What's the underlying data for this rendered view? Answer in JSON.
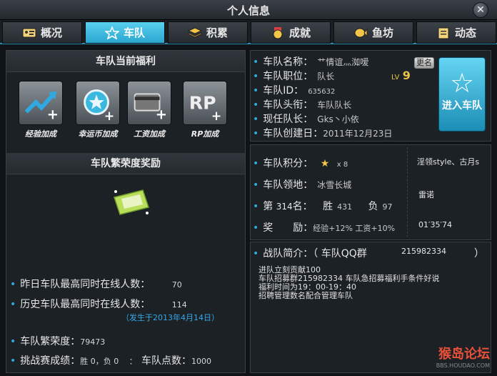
{
  "window": {
    "title": "个人信息",
    "close_glyph": "✕"
  },
  "tabs": [
    {
      "label": "概况",
      "icon": "id-card-icon",
      "active": false
    },
    {
      "label": "车队",
      "icon": "star-icon",
      "active": true
    },
    {
      "label": "积累",
      "icon": "stack-icon",
      "active": false
    },
    {
      "label": "成就",
      "icon": "medal-icon",
      "active": false
    },
    {
      "label": "鱼坊",
      "icon": "fish-icon",
      "active": false
    },
    {
      "label": "动态",
      "icon": "notepad-icon",
      "active": false
    }
  ],
  "benefits": {
    "title": "车队当前福利",
    "items": [
      {
        "label": "经验加成",
        "icon": "exp-up-icon"
      },
      {
        "label": "幸运币加成",
        "icon": "coin-plus-icon"
      },
      {
        "label": "工资加成",
        "icon": "card-plus-icon"
      },
      {
        "label": "RP加成",
        "icon": "rp-plus-icon"
      }
    ]
  },
  "prosperity": {
    "title": "车队繁荣度奖励",
    "reward_icon": "ticket-icon"
  },
  "online": {
    "yesterday_label": "昨日车队最高同时在线人数：",
    "yesterday_value": "70",
    "history_label": "历史车队最高同时在线人数：",
    "history_value": "114",
    "history_date": "（发生于2013年4月14日）"
  },
  "prosperity_value": {
    "label": "车队繁荣度：",
    "value": "79473"
  },
  "challenge": {
    "label": "挑战赛成绩：",
    "value": "胜 0，负 0",
    "sep": "："
  },
  "team_points": {
    "label": "车队点数：",
    "value": "1000"
  },
  "team": {
    "name_label": "车队名称：",
    "name": "艹情谊灬洳嗳",
    "position_label": "车队职位：",
    "position": "队长",
    "lv_label": "LV",
    "lv": "9",
    "id_label": "车队ID：",
    "id": "635632",
    "rank_title_label": "车队头衔：",
    "rank_title": "车队队长",
    "leader_label": "现任队长：",
    "leader": "Gks丶小依",
    "created_label": "车队创建日：",
    "created": "2011年12月23日",
    "rename_button": "更名",
    "join_button": "进入车队"
  },
  "score": {
    "points_label": "车队积分：",
    "points_star": "★",
    "points_value": "x 8",
    "territory_label": "车队领地：",
    "territory": "冰雪长城",
    "rank_prefix": "第",
    "rank": "314",
    "rank_suffix": "名：",
    "win_label": "胜",
    "wins": "431",
    "loss_label": "负",
    "losses": "97",
    "reward_label": "奖　　励：",
    "reward": "经验+12% 工资+10%",
    "side_1": "淫领style、古月s",
    "side_2": "雷诺",
    "side_3": "01′35′74"
  },
  "intro": {
    "label": "战队简介：（ 车队QQ群",
    "qq": "215982334",
    "close_paren": "）",
    "lines": [
      "进队立刻贡献100",
      "  车队招募群215982334 车队急招募福利手条件好说",
      "福利时间为19：00-19：40",
      "招聘管理数名配合管理车队"
    ]
  },
  "watermark": {
    "logo": "猴岛论坛",
    "url": "BBS.HOUDAO.COM"
  },
  "colors": {
    "accent": "#2aa6cf",
    "highlight_blue": "#36a9e8",
    "lv_gold": "#e8c24a"
  }
}
